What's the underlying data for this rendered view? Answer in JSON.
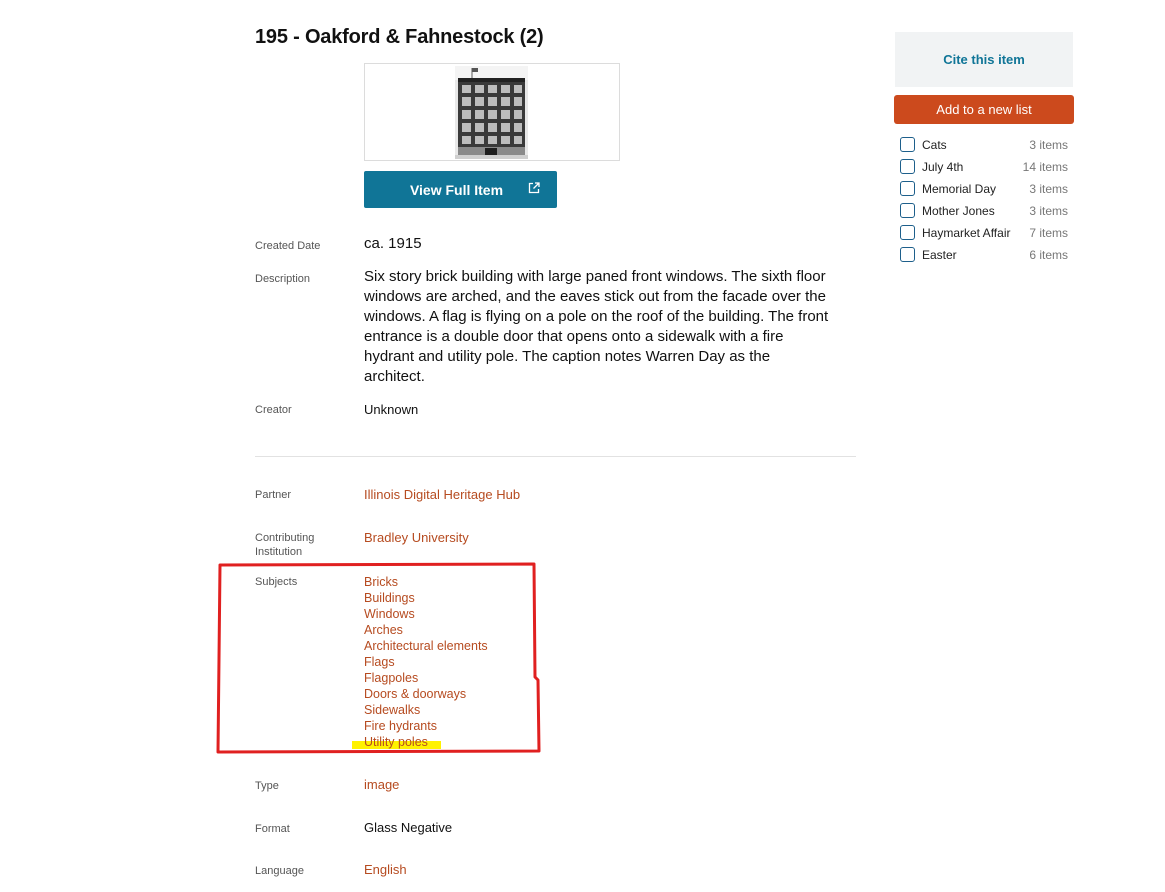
{
  "item": {
    "title": "195 - Oakford & Fahnestock (2)",
    "view_button": "View Full Item",
    "fields": {
      "created_date": {
        "label": "Created Date",
        "value": "ca. 1915"
      },
      "description": {
        "label": "Description",
        "value": "Six story brick building with large paned front windows. The sixth floor windows are arched, and the eaves stick out from the facade over the windows. A flag is flying on a pole on the roof of the building. The front entrance is a double door that opens onto a sidewalk with a fire hydrant and utility pole. The caption notes Warren Day as the architect."
      },
      "creator": {
        "label": "Creator",
        "value": "Unknown"
      },
      "partner": {
        "label": "Partner",
        "value": "Illinois Digital Heritage Hub"
      },
      "contributing_institution": {
        "label": "Contributing Institution",
        "value": "Bradley University"
      },
      "subjects": {
        "label": "Subjects",
        "values": [
          "Bricks",
          "Buildings",
          "Windows",
          "Arches",
          "Architectural elements",
          "Flags",
          "Flagpoles",
          "Doors & doorways",
          "Sidewalks",
          "Fire hydrants",
          "Utility poles"
        ]
      },
      "type": {
        "label": "Type",
        "value": "image"
      },
      "format": {
        "label": "Format",
        "value": "Glass Negative"
      },
      "language": {
        "label": "Language",
        "value": "English"
      }
    }
  },
  "sidebar": {
    "cite_label": "Cite this item",
    "add_list_label": "Add to a new list",
    "lists": [
      {
        "name": "Cats",
        "count": "3 items"
      },
      {
        "name": "July 4th",
        "count": "14 items"
      },
      {
        "name": "Memorial Day",
        "count": "3 items"
      },
      {
        "name": "Mother Jones",
        "count": "3 items"
      },
      {
        "name": "Haymarket Affair",
        "count": "7 items"
      },
      {
        "name": "Easter",
        "count": "6 items"
      }
    ]
  },
  "colors": {
    "accent": "#107597",
    "link": "#b64b20",
    "add_button": "#cc4a1d",
    "annotation": "#e02020",
    "highlight": "#fff200"
  },
  "icons": {
    "view_button": "external-link-icon"
  }
}
